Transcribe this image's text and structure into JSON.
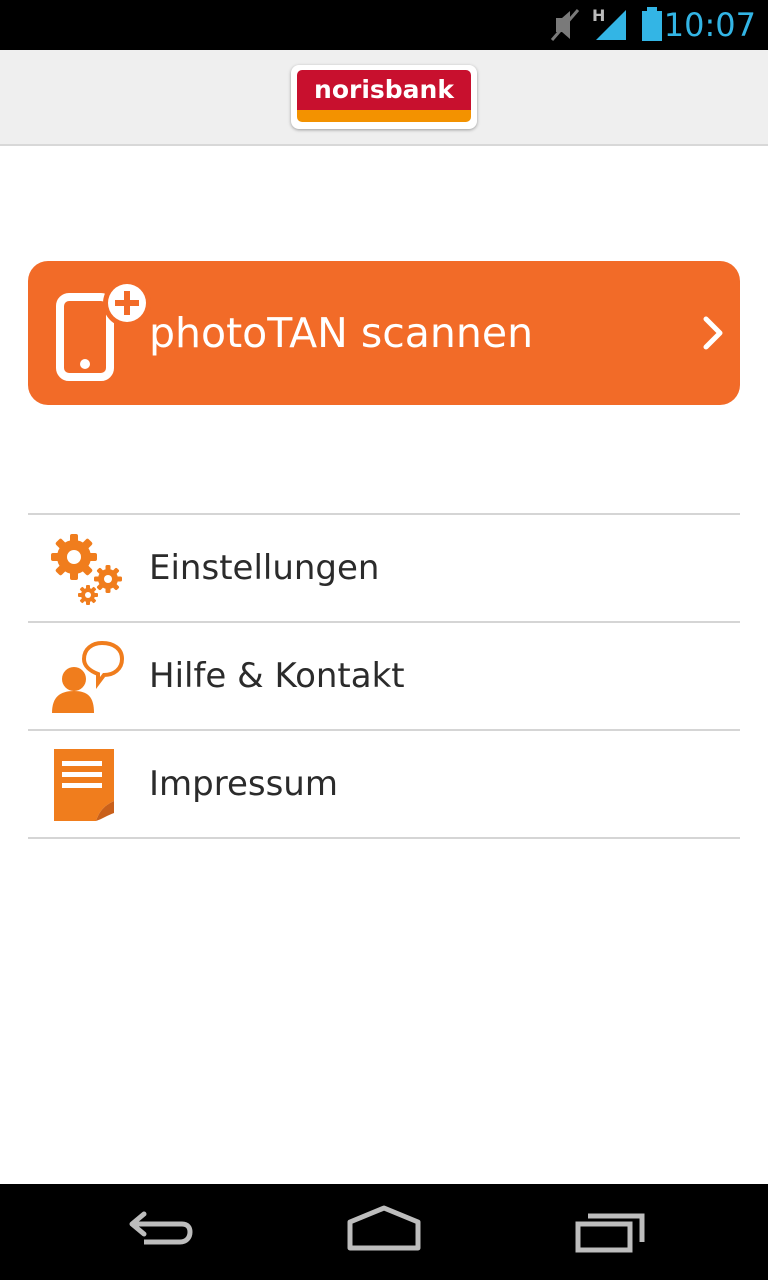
{
  "status_bar": {
    "time": "10:07",
    "network_label": "H",
    "icons": [
      "mute-icon",
      "signal-icon",
      "battery-icon"
    ],
    "icon_color": "#33b5e5"
  },
  "header": {
    "logo_text": "norisbank",
    "background": "#efefef"
  },
  "main_action": {
    "label": "photoTAN scannen",
    "icon": "phone-plus-icon",
    "color": "#f26b28"
  },
  "menu": {
    "items": [
      {
        "label": "Einstellungen",
        "icon": "gears-icon"
      },
      {
        "label": "Hilfe & Kontakt",
        "icon": "help-contact-icon"
      },
      {
        "label": "Impressum",
        "icon": "document-icon"
      }
    ],
    "icon_color": "#f07d1d"
  },
  "nav_bar": {
    "buttons": [
      "back",
      "home",
      "recent-apps"
    ]
  }
}
